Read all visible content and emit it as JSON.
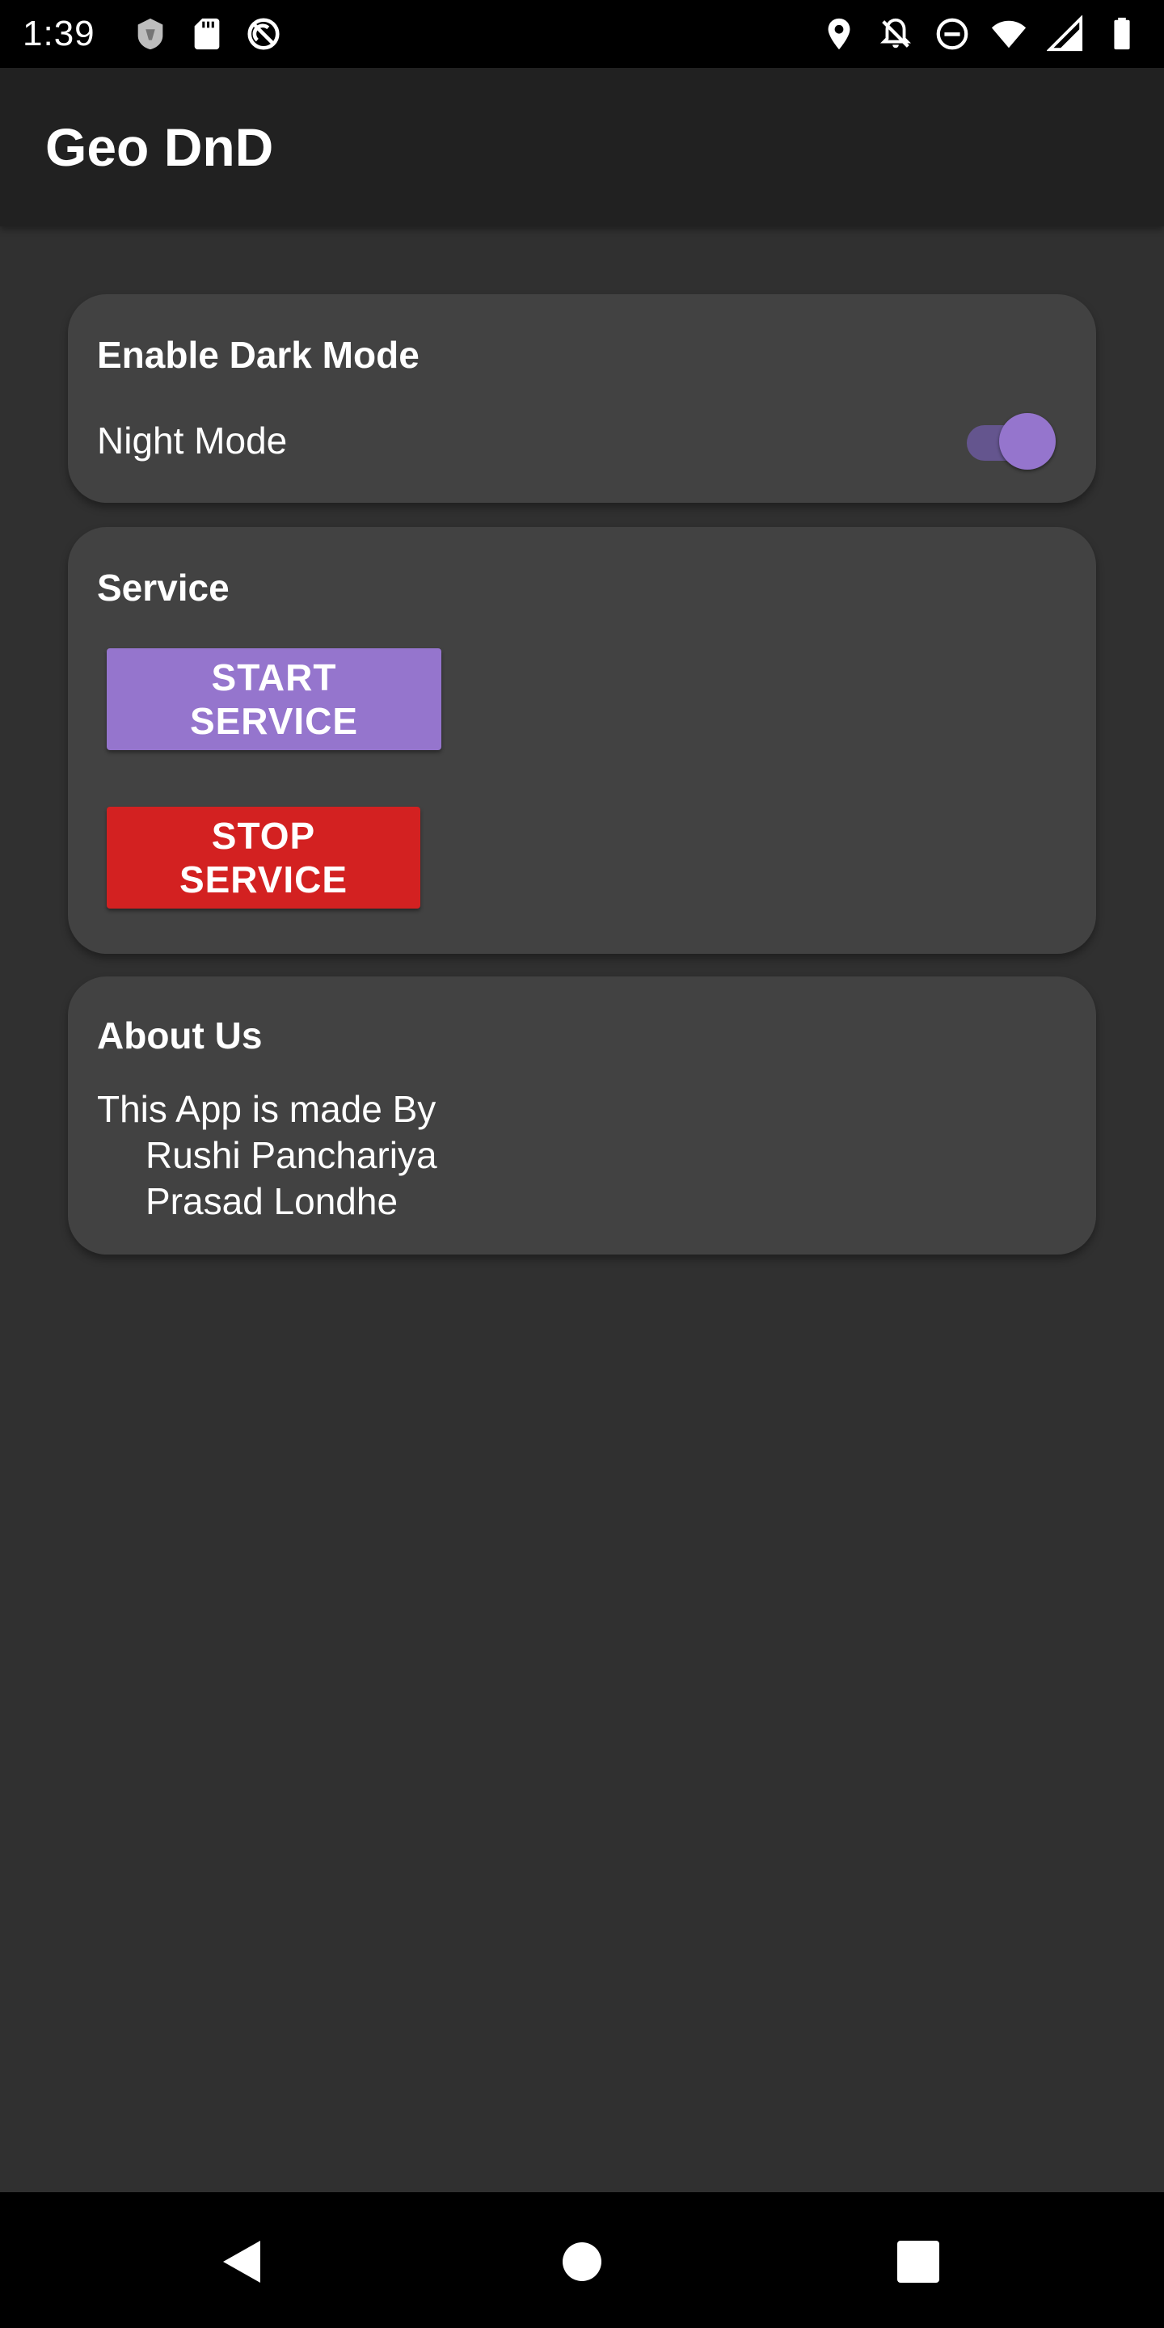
{
  "status_bar": {
    "time": "1:39"
  },
  "app_bar": {
    "title": "Geo DnD"
  },
  "dark_mode_card": {
    "title": "Enable Dark Mode",
    "label": "Night Mode",
    "switch_on": true
  },
  "service_card": {
    "title": "Service",
    "start_label": "START SERVICE",
    "stop_label": "STOP SERVICE"
  },
  "about_card": {
    "title": "About Us",
    "line1": "This App is made By",
    "line2": "Rushi Panchariya",
    "line3": "Prasad Londhe"
  },
  "colors": {
    "accent": "#9575cd",
    "stop": "#d32121",
    "card": "#424242",
    "background": "#303030",
    "app_bar": "#212121"
  },
  "icons": {
    "status_left": [
      "vpn-shield-icon",
      "sd-card-icon",
      "no-sync-icon"
    ],
    "status_right": [
      "location-icon",
      "notifications-off-icon",
      "do-not-disturb-icon",
      "wifi-icon",
      "cell-signal-icon",
      "battery-icon"
    ],
    "nav": [
      "back-icon",
      "home-icon",
      "recents-icon"
    ]
  }
}
